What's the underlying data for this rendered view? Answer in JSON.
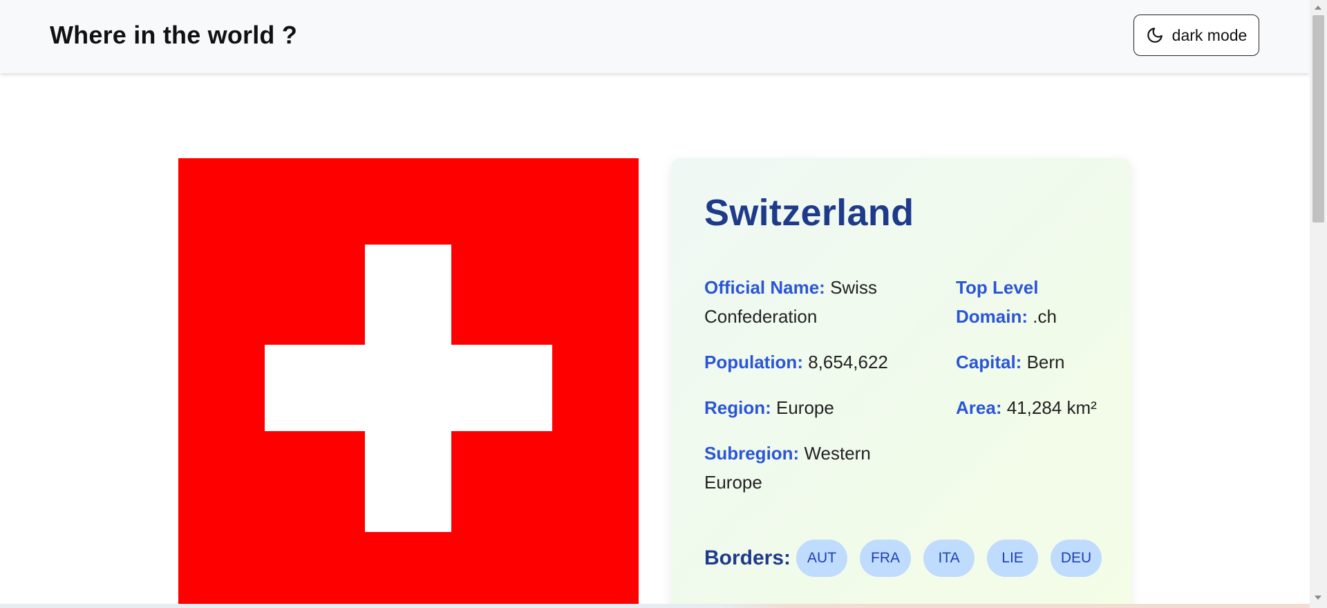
{
  "header": {
    "title": "Where in the world ?",
    "mode_button": {
      "icon": "moon-icon",
      "label": "dark mode"
    }
  },
  "flag": {
    "country": "Switzerland",
    "colors": {
      "background": "#ff0000",
      "cross": "#ffffff"
    }
  },
  "country": {
    "name": "Switzerland",
    "left_fields": [
      {
        "key": "Official Name:",
        "value": "Swiss Confederation"
      },
      {
        "key": "Population:",
        "value": "8,654,622"
      },
      {
        "key": "Region:",
        "value": "Europe"
      },
      {
        "key": "Subregion:",
        "value": "Western Europe"
      }
    ],
    "right_fields": [
      {
        "key": "Top Level Domain:",
        "value": ".ch"
      },
      {
        "key": "Capital:",
        "value": "Bern"
      },
      {
        "key": "Area:",
        "value": "41,284 km²"
      }
    ],
    "borders_label": "Borders:",
    "borders": [
      "AUT",
      "FRA",
      "ITA",
      "LIE",
      "DEU"
    ]
  },
  "colors": {
    "accent": "#1e3a8a",
    "label": "#2a55d6",
    "chip_bg": "#bfdbfe",
    "chip_text": "#1e40af",
    "header_bg": "#f8f9fa"
  }
}
